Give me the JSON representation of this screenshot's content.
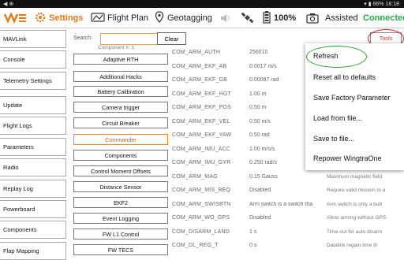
{
  "status_bar": {
    "signal": "◀  ⊕",
    "battery": "66%",
    "time": "18:18"
  },
  "toolbar": {
    "settings_label": "Settings",
    "flight_plan_label": "Flight Plan",
    "geotagging_label": "Geotagging",
    "battery_percent": "100%",
    "mode_label": "Assisted",
    "connection_label": "Connected",
    "accent_color": "#e07a1a",
    "connected_color": "#26a84a"
  },
  "sidebar": {
    "items": [
      {
        "label": "MAVLink"
      },
      {
        "label": "Console"
      },
      {
        "label": "Telemetry Settings"
      },
      {
        "label": "Update"
      },
      {
        "label": "Flight Logs"
      },
      {
        "label": "Parameters"
      },
      {
        "label": "Radio"
      },
      {
        "label": "Replay Log"
      },
      {
        "label": "Powerboard"
      },
      {
        "label": "Components"
      },
      {
        "label": "Flap Mapping"
      }
    ]
  },
  "search": {
    "label": "Search:",
    "value": "",
    "clear_label": "Clear"
  },
  "tools_label": "Tools",
  "component_label": "Component #: 1",
  "components": [
    {
      "label": "Adaptive RTH",
      "selected": false
    },
    {
      "label": "Additional Hacks",
      "selected": false
    },
    {
      "label": "Battery Calibration",
      "selected": false
    },
    {
      "label": "Camera trigger",
      "selected": false
    },
    {
      "label": "Circuit Breaker",
      "selected": false
    },
    {
      "label": "Commander",
      "selected": true
    },
    {
      "label": "Components",
      "selected": false
    },
    {
      "label": "Control Moment Offsets",
      "selected": false
    },
    {
      "label": "Distance Sensor",
      "selected": false
    },
    {
      "label": "EKF2",
      "selected": false
    },
    {
      "label": "Event Logging",
      "selected": false
    },
    {
      "label": "FW L1 Control",
      "selected": false
    },
    {
      "label": "FW TECS",
      "selected": false
    }
  ],
  "params": [
    {
      "name": "COM_ARM_AUTH",
      "value": "256010",
      "desc": ""
    },
    {
      "name": "COM_ARM_EKF_AB",
      "value": "0.0017 m/s",
      "desc": ""
    },
    {
      "name": "COM_ARM_EKF_GB",
      "value": "0.00087 rad",
      "desc": ""
    },
    {
      "name": "COM_ARM_EKF_HGT",
      "value": "1.00 m",
      "desc": ""
    },
    {
      "name": "COM_ARM_EKF_POS",
      "value": "0.50 m",
      "desc": ""
    },
    {
      "name": "COM_ARM_EKF_VEL",
      "value": "0.50 m/s",
      "desc": ""
    },
    {
      "name": "COM_ARM_EKF_YAW",
      "value": "0.50 rad",
      "desc": ""
    },
    {
      "name": "COM_ARM_IMU_ACC",
      "value": "1.00 m/s/s",
      "desc": ""
    },
    {
      "name": "COM_ARM_IMU_GYR",
      "value": "0.250 rad/s",
      "desc": ""
    },
    {
      "name": "COM_ARM_MAG",
      "value": "0.15 Gauss",
      "desc": "Maximum magnetic field"
    },
    {
      "name": "COM_ARM_MIS_REQ",
      "value": "Disabled",
      "desc": "Require valid mission to a"
    },
    {
      "name": "COM_ARM_SWISBTN",
      "value": "Arm switch is a switch tha",
      "desc": "Arm switch is only a butt"
    },
    {
      "name": "COM_ARM_WO_GPS",
      "value": "Disabled",
      "desc": "Allow arming without GPS"
    },
    {
      "name": "COM_DISARM_LAND",
      "value": "1 s",
      "desc": "Time-out for auto disarm"
    },
    {
      "name": "COM_DL_REG_T",
      "value": "0 s",
      "desc": "Datalink regain time th"
    }
  ],
  "menu": {
    "items": [
      {
        "label": "Refresh"
      },
      {
        "label": "Reset all to defaults"
      },
      {
        "label": "Save Factory Parameter"
      },
      {
        "label": "Load from file..."
      },
      {
        "label": "Save to file..."
      },
      {
        "label": "Repower WingtraOne"
      }
    ]
  }
}
